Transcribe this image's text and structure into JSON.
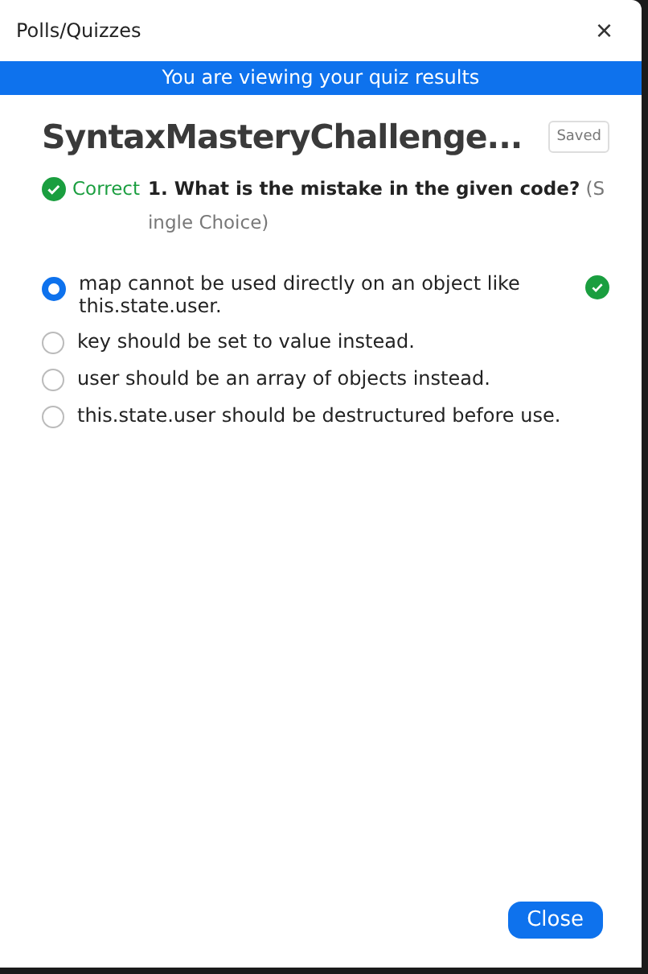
{
  "window": {
    "title": "Polls/Quizzes",
    "close": "×"
  },
  "banner": "You are viewing your quiz results",
  "quiz": {
    "title": "SyntaxMasteryChallenge...",
    "badge": "Saved"
  },
  "question": {
    "result": "Correct",
    "correct": true,
    "text": "**1. What is the mistake in the given code?** (Single Choice)"
  },
  "options": [
    {
      "label": "map cannot be used directly on an object like this.state.user.",
      "selected": true,
      "correct": true
    },
    {
      "label": "key should be set to value instead.",
      "selected": false,
      "correct": false
    },
    {
      "label": "user should be an array of objects instead.",
      "selected": false,
      "correct": false
    },
    {
      "label": "this.state.user should be destructured before use.",
      "selected": false,
      "correct": false
    }
  ],
  "buttons": [
    "Close"
  ]
}
